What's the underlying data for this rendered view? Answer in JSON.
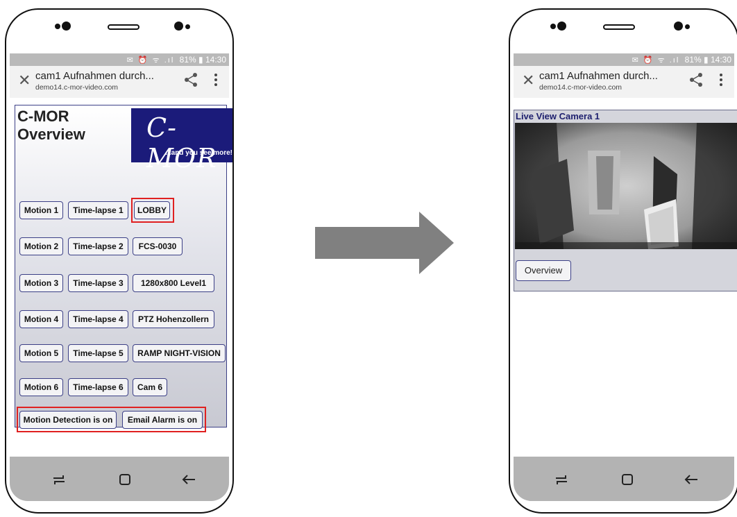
{
  "status": {
    "icons": "✉ ⏰ ᯤ .ıl",
    "battery": "81%",
    "time": "14:30"
  },
  "browser": {
    "tab_title": "cam1 Aufnahmen durch...",
    "host": "demo14.c-mor-video.com"
  },
  "left": {
    "heading_line1": "C-MOR",
    "heading_line2": "Overview",
    "logo_text": "C-MOR",
    "logo_tagline": "...and you see more!",
    "rows": [
      [
        "Motion 1",
        "Time-lapse 1",
        "LOBBY"
      ],
      [
        "Motion 2",
        "Time-lapse 2",
        "FCS-0030"
      ],
      [
        "Motion 3",
        "Time-lapse 3",
        "1280x800 Level1"
      ],
      [
        "Motion 4",
        "Time-lapse 4",
        "PTZ Hohenzollern"
      ],
      [
        "Motion 5",
        "Time-lapse 5",
        "RAMP NIGHT-VISION"
      ],
      [
        "Motion 6",
        "Time-lapse 6",
        "Cam 6"
      ]
    ],
    "motion_detection": "Motion Detection is on",
    "email_alarm": "Email Alarm is on"
  },
  "right": {
    "live_title": "Live View Camera 1",
    "overview": "Overview"
  },
  "colors": {
    "highlight": "#e02020",
    "logo_bg": "#1b1b7a",
    "arrow": "#808080",
    "button_border": "#3b3f86"
  }
}
